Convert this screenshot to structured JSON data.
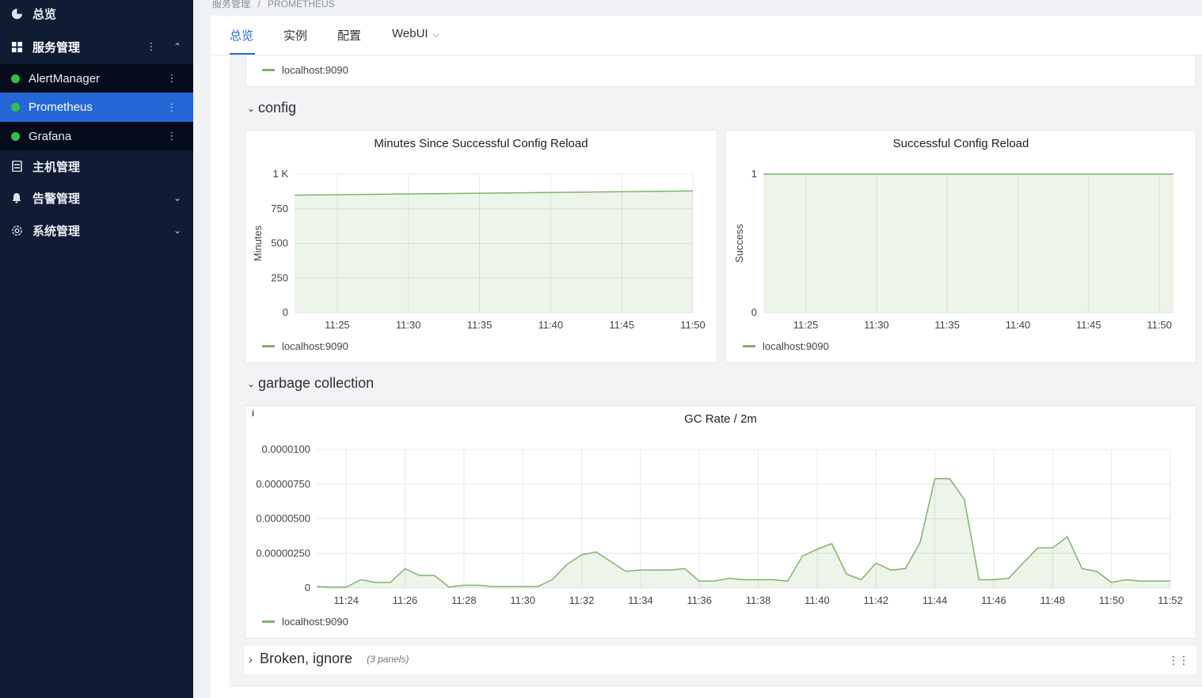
{
  "sidebar": {
    "overview": {
      "label": "总览",
      "icon": "dashboard-icon"
    },
    "service": {
      "label": "服务管理",
      "icon": "grid-icon",
      "more": "⋮",
      "chevron": "⌃"
    },
    "services": [
      {
        "label": "AlertManager",
        "status_color": "#2ec24b",
        "more": "⋮"
      },
      {
        "label": "Prometheus",
        "status_color": "#2ec24b",
        "more": "⋮"
      },
      {
        "label": "Grafana",
        "status_color": "#2ec24b",
        "more": "⋮"
      }
    ],
    "host": {
      "label": "主机管理",
      "icon": "server-icon"
    },
    "alert": {
      "label": "告警管理",
      "icon": "bell-icon",
      "chevron": "⌄"
    },
    "system": {
      "label": "系统管理",
      "icon": "gear-icon",
      "chevron": "⌄"
    }
  },
  "breadcrumb": {
    "parent": "服务管理",
    "separator": "/",
    "current": "PROMETHEUS"
  },
  "tabs": [
    {
      "label": "总览",
      "active": true
    },
    {
      "label": "实例"
    },
    {
      "label": "配置"
    },
    {
      "label": "WebUI",
      "dropdown": "⌵"
    }
  ],
  "dashboard": {
    "prev_legend": "localhost:9090",
    "rows": {
      "config": {
        "title": "config",
        "caret": "⌄"
      },
      "gc": {
        "title": "garbage collection",
        "caret": "⌄"
      },
      "broken": {
        "title": "Broken, ignore",
        "caret": "›",
        "note": "(3 panels)"
      }
    },
    "gc_info": "i",
    "drag_handle": "⋮⋮"
  },
  "accent_color": "#2468d8",
  "series_color": "#7fb36a",
  "chart_data": [
    {
      "type": "area",
      "title": "Minutes Since Successful Config Reload",
      "ylabel": "Minutes",
      "xlabel": "",
      "x": [
        "11:22",
        "11:50"
      ],
      "xticks": [
        "11:25",
        "11:30",
        "11:35",
        "11:40",
        "11:45",
        "11:50"
      ],
      "yticks": [
        "0",
        "250",
        "500",
        "750",
        "1 K"
      ],
      "ylim": [
        0,
        1000
      ],
      "grid": true,
      "series": [
        {
          "name": "localhost:9090",
          "values": [
            848,
            878
          ]
        }
      ]
    },
    {
      "type": "area",
      "title": "Successful Config Reload",
      "ylabel": "Success",
      "xlabel": "",
      "x": [
        "11:22",
        "11:51"
      ],
      "xticks": [
        "11:25",
        "11:30",
        "11:35",
        "11:40",
        "11:45",
        "11:50"
      ],
      "yticks": [
        "0",
        "1"
      ],
      "ylim": [
        0,
        1
      ],
      "grid": true,
      "series": [
        {
          "name": "localhost:9090",
          "values": [
            1,
            1
          ]
        }
      ]
    },
    {
      "type": "area",
      "title": "GC Rate / 2m",
      "ylabel": "",
      "xlabel": "",
      "x": [
        "11:23",
        "11:23:30",
        "11:24",
        "11:24:30",
        "11:25",
        "11:25:30",
        "11:26",
        "11:26:30",
        "11:27",
        "11:27:30",
        "11:28",
        "11:28:30",
        "11:29",
        "11:29:30",
        "11:30",
        "11:30:30",
        "11:31",
        "11:31:30",
        "11:32",
        "11:32:30",
        "11:33",
        "11:33:30",
        "11:34",
        "11:34:30",
        "11:35",
        "11:35:30",
        "11:36",
        "11:36:30",
        "11:37",
        "11:37:30",
        "11:38",
        "11:38:30",
        "11:39",
        "11:39:30",
        "11:40",
        "11:40:30",
        "11:41",
        "11:41:30",
        "11:42",
        "11:42:30",
        "11:43",
        "11:43:30",
        "11:44",
        "11:44:30",
        "11:45",
        "11:45:30",
        "11:46",
        "11:46:30",
        "11:47",
        "11:47:30",
        "11:48",
        "11:48:30",
        "11:49",
        "11:49:30",
        "11:50",
        "11:50:30",
        "11:51",
        "11:51:30",
        "11:52"
      ],
      "xticks": [
        "11:24",
        "11:26",
        "11:28",
        "11:30",
        "11:32",
        "11:34",
        "11:36",
        "11:38",
        "11:40",
        "11:42",
        "11:44",
        "11:46",
        "11:48",
        "11:50",
        "11:52"
      ],
      "yticks": [
        "0",
        "0.00000250",
        "0.00000500",
        "0.00000750",
        "0.0000100"
      ],
      "ylim": [
        0,
        1e-05
      ],
      "grid": true,
      "series": [
        {
          "name": "localhost:9090",
          "values": [
            1e-07,
            6e-08,
            6e-08,
            6e-07,
            4e-07,
            4e-07,
            1.4e-06,
            9e-07,
            9e-07,
            6e-08,
            2e-07,
            2e-07,
            1e-07,
            1e-07,
            1e-07,
            1e-07,
            6e-07,
            1.7e-06,
            2.4e-06,
            2.6e-06,
            1.9e-06,
            1.2e-06,
            1.3e-06,
            1.3e-06,
            1.3e-06,
            1.4e-06,
            5e-07,
            5e-07,
            7e-07,
            6e-07,
            6e-07,
            6e-07,
            5e-07,
            2.3e-06,
            2.8e-06,
            3.2e-06,
            1e-06,
            6e-07,
            1.8e-06,
            1.3e-06,
            1.4e-06,
            3.3e-06,
            7.9e-06,
            7.9e-06,
            6.4e-06,
            6e-07,
            6e-07,
            7e-07,
            1.8e-06,
            2.9e-06,
            2.9e-06,
            3.7e-06,
            1.4e-06,
            1.2e-06,
            4e-07,
            6e-07,
            5e-07,
            5e-07,
            5e-07
          ]
        }
      ]
    }
  ]
}
